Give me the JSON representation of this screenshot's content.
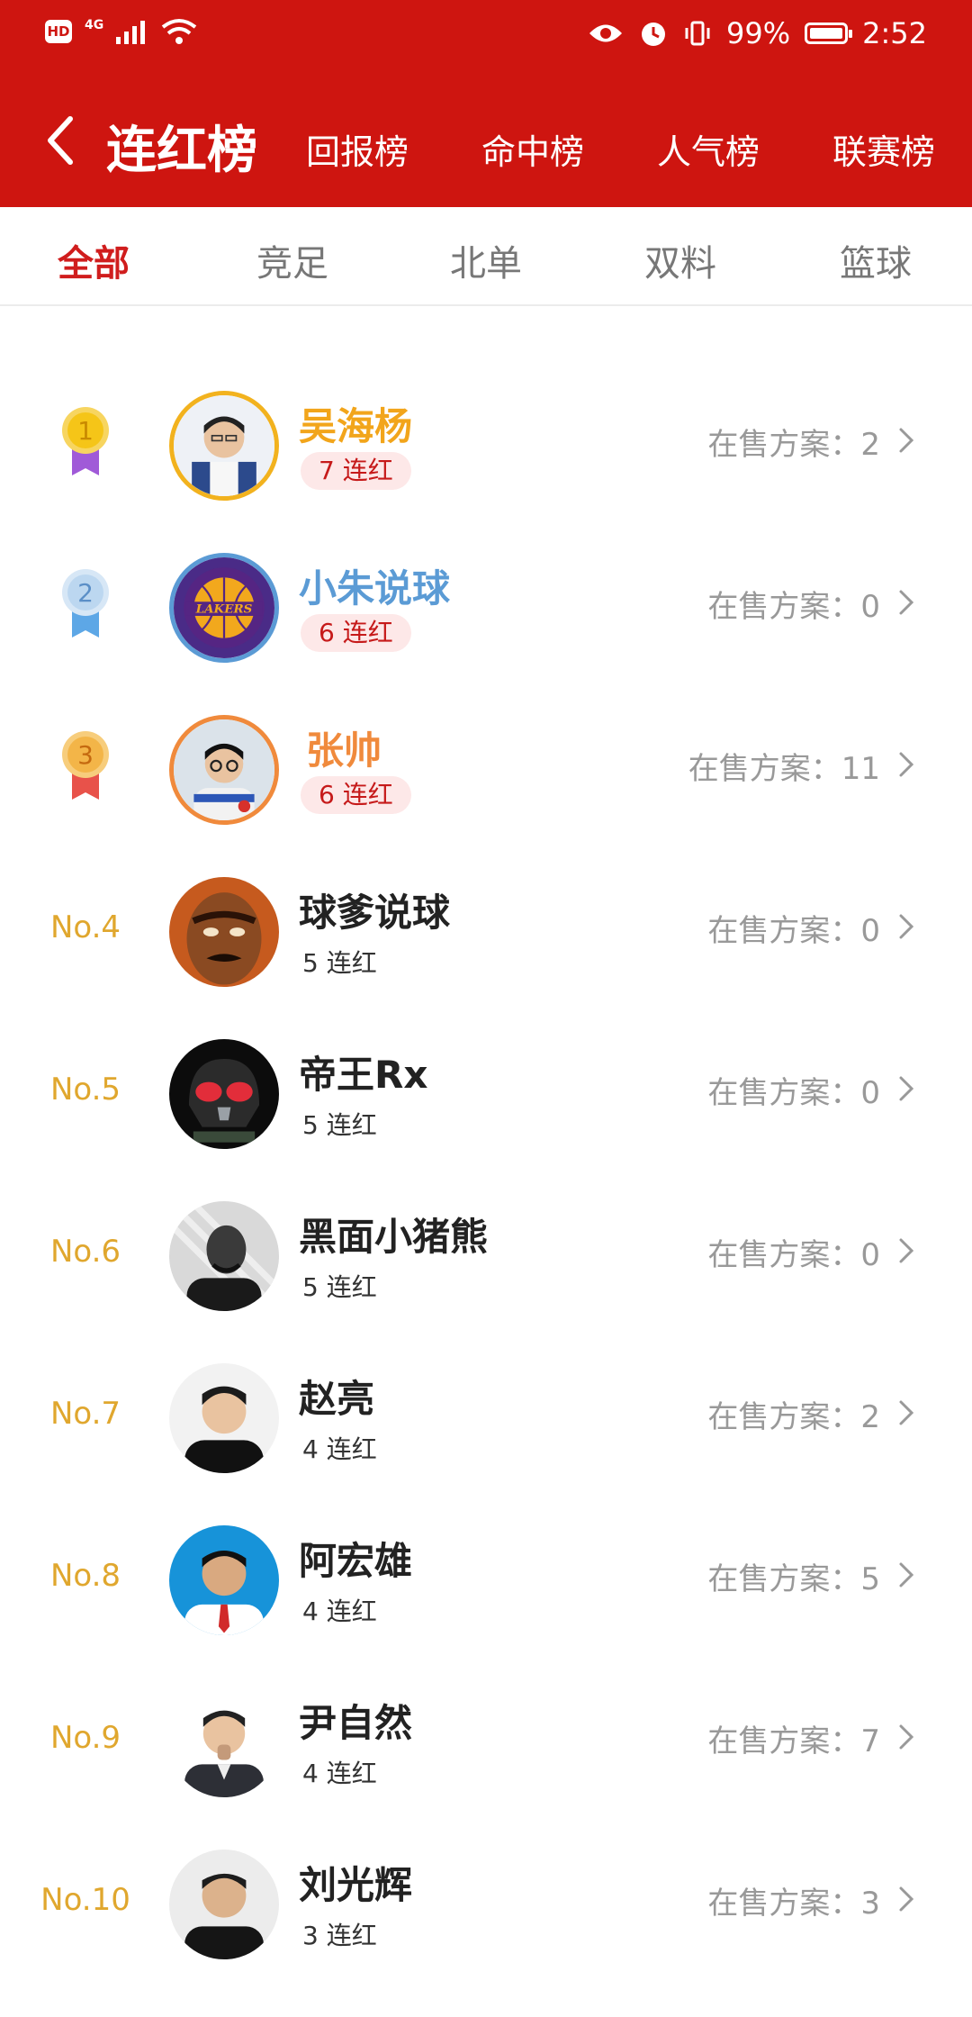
{
  "status_bar": {
    "hd": "HD",
    "signal": "4G",
    "battery_pct": "99%",
    "battery_level": 0.99,
    "time": "2:52"
  },
  "nav": {
    "title": "连红榜",
    "tabs": [
      "回报榜",
      "命中榜",
      "人气榜",
      "联赛榜"
    ]
  },
  "categories": {
    "items": [
      "全部",
      "竞足",
      "北单",
      "双料",
      "篮球"
    ],
    "active": "全部"
  },
  "colors": {
    "header": "#ce1510",
    "gold": "#f2b21e",
    "silver": "#5b9bd5",
    "bronze": "#f08a3c",
    "rank_text": "#e0a72e"
  },
  "list": {
    "plans_label": "在售方案：",
    "rows": [
      {
        "rank": "1",
        "name": "吴海杨",
        "streak": "7 连红",
        "plans": "2",
        "name_color": "#f2a51b",
        "medal": "gold",
        "avatar": "man-white-shirt-icon"
      },
      {
        "rank": "2",
        "name": "小朱说球",
        "streak": "6 连红",
        "plans": "0",
        "name_color": "#5b9bd5",
        "medal": "silver",
        "avatar": "lakers-logo-icon"
      },
      {
        "rank": "3",
        "name": "张帅",
        "streak": "6 连红",
        "plans": "11",
        "name_color": "#f08a3c",
        "medal": "bronze",
        "avatar": "man-glasses-icon"
      },
      {
        "rank": "No.4",
        "name": "球爹说球",
        "streak": "5 连红",
        "plans": "0",
        "avatar": "cartoon-face-icon"
      },
      {
        "rank": "No.5",
        "name": "帝王Rx",
        "streak": "5 连红",
        "plans": "0",
        "avatar": "helmet-character-icon"
      },
      {
        "rank": "No.6",
        "name": "黑面小猪熊",
        "streak": "5 连红",
        "plans": "0",
        "avatar": "man-portrait-bw-icon"
      },
      {
        "rank": "No.7",
        "name": "赵亮",
        "streak": "4 连红",
        "plans": "2",
        "avatar": "man-black-shirt-icon"
      },
      {
        "rank": "No.8",
        "name": "阿宏雄",
        "streak": "4 连红",
        "plans": "5",
        "avatar": "man-blue-bg-icon"
      },
      {
        "rank": "No.9",
        "name": "尹自然",
        "streak": "4 连红",
        "plans": "7",
        "avatar": "man-suit-icon"
      },
      {
        "rank": "No.10",
        "name": "刘光辉",
        "streak": "3 连红",
        "plans": "3",
        "avatar": "man-black-tee-icon"
      }
    ]
  }
}
